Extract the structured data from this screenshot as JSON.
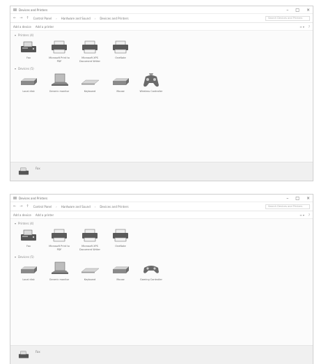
{
  "windows": [
    {
      "title": "Devices and Printers",
      "crumbs": [
        "Control Panel",
        "Hardware and Sound",
        "Devices and Printers"
      ],
      "search_placeholder": "Search Devices and Printers",
      "cmd": [
        "Add a device",
        "Add a printer"
      ],
      "printers_group": "Printers (4)",
      "printers": [
        "Fax",
        "Microsoft Print to PDF",
        "Microsoft XPS Document Writer",
        "OneNote"
      ],
      "devices_group": "Devices (5)",
      "devices": [
        "Local disk",
        "Generic monitor",
        "Keyboard",
        "Mouse",
        "Wireless Controller"
      ],
      "status_text": "Fax"
    },
    {
      "title": "Devices and Printers",
      "crumbs": [
        "Control Panel",
        "Hardware and Sound",
        "Devices and Printers"
      ],
      "search_placeholder": "Search Devices and Printers",
      "cmd": [
        "Add a device",
        "Add a printer"
      ],
      "printers_group": "Printers (4)",
      "printers": [
        "Fax",
        "Microsoft Print to PDF",
        "Microsoft XPS Document Writer",
        "OneNote"
      ],
      "devices_group": "Devices (5)",
      "devices": [
        "Local disk",
        "Generic monitor",
        "Keyboard",
        "Mouse",
        "Gaming Controller"
      ],
      "status_text": "Fax"
    }
  ]
}
